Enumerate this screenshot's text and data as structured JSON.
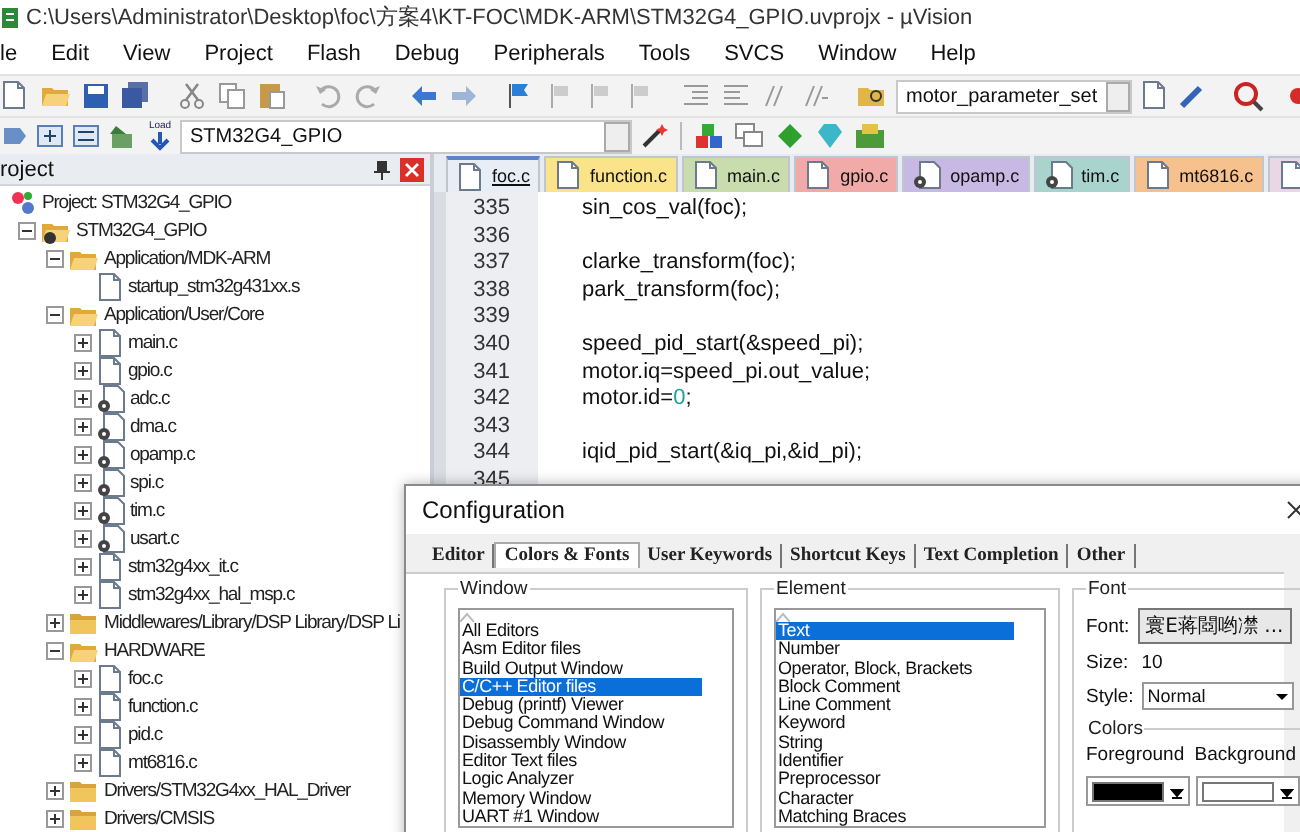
{
  "window": {
    "title": "C:\\Users\\Administrator\\Desktop\\foc\\方案4\\KT-FOC\\MDK-ARM\\STM32G4_GPIO.uvprojx - µVision"
  },
  "menu": [
    "le",
    "Edit",
    "View",
    "Project",
    "Flash",
    "Debug",
    "Peripherals",
    "Tools",
    "SVCS",
    "Window",
    "Help"
  ],
  "toolbar": {
    "find_combo": "motor_parameter_set",
    "load_label": "Load",
    "target_combo": "STM32G4_GPIO"
  },
  "project_panel": {
    "title": "roject",
    "tree": [
      {
        "label": "Project: STM32G4_GPIO",
        "kind": "project",
        "children": [
          {
            "label": "STM32G4_GPIO",
            "kind": "target",
            "expanded": true,
            "children": [
              {
                "label": "Application/MDK-ARM",
                "kind": "folder",
                "expanded": true,
                "children": [
                  {
                    "label": "startup_stm32g431xx.s",
                    "kind": "file"
                  }
                ]
              },
              {
                "label": "Application/User/Core",
                "kind": "folder",
                "expanded": true,
                "children": [
                  {
                    "label": "main.c",
                    "kind": "file",
                    "expanded": false
                  },
                  {
                    "label": "gpio.c",
                    "kind": "file",
                    "expanded": false
                  },
                  {
                    "label": "adc.c",
                    "kind": "config-file",
                    "expanded": false
                  },
                  {
                    "label": "dma.c",
                    "kind": "config-file",
                    "expanded": false
                  },
                  {
                    "label": "opamp.c",
                    "kind": "config-file",
                    "expanded": false
                  },
                  {
                    "label": "spi.c",
                    "kind": "config-file",
                    "expanded": false
                  },
                  {
                    "label": "tim.c",
                    "kind": "config-file",
                    "expanded": false
                  },
                  {
                    "label": "usart.c",
                    "kind": "config-file",
                    "expanded": false
                  },
                  {
                    "label": "stm32g4xx_it.c",
                    "kind": "file",
                    "expanded": false
                  },
                  {
                    "label": "stm32g4xx_hal_msp.c",
                    "kind": "file",
                    "expanded": false
                  }
                ]
              },
              {
                "label": "Middlewares/Library/DSP Library/DSP Li",
                "kind": "folder",
                "expanded": false
              },
              {
                "label": "HARDWARE",
                "kind": "folder",
                "expanded": true,
                "children": [
                  {
                    "label": "foc.c",
                    "kind": "file",
                    "expanded": false
                  },
                  {
                    "label": "function.c",
                    "kind": "file",
                    "expanded": false
                  },
                  {
                    "label": "pid.c",
                    "kind": "file",
                    "expanded": false
                  },
                  {
                    "label": "mt6816.c",
                    "kind": "file",
                    "expanded": false
                  }
                ]
              },
              {
                "label": "Drivers/STM32G4xx_HAL_Driver",
                "kind": "folder",
                "expanded": false
              },
              {
                "label": "Drivers/CMSIS",
                "kind": "folder",
                "expanded": false
              }
            ]
          }
        ]
      }
    ]
  },
  "editor": {
    "tabs": [
      {
        "label": "foc.c",
        "kind": "file",
        "color": "#e8eef6",
        "selected": true
      },
      {
        "label": "function.c",
        "kind": "file",
        "color": "#fbe38a",
        "selected": false
      },
      {
        "label": "main.c",
        "kind": "file",
        "color": "#c9dcae",
        "selected": false
      },
      {
        "label": "gpio.c",
        "kind": "file",
        "color": "#f2aaa8",
        "selected": false
      },
      {
        "label": "opamp.c",
        "kind": "config-file",
        "color": "#c7b8e4",
        "selected": false
      },
      {
        "label": "tim.c",
        "kind": "config-file",
        "color": "#a8d4cd",
        "selected": false
      },
      {
        "label": "mt6816.c",
        "kind": "file",
        "color": "#f7c18e",
        "selected": false
      },
      {
        "kind": "file",
        "color": "#ead7e6",
        "selected": false
      }
    ],
    "lines": [
      {
        "number": "335",
        "segments": [
          {
            "text": "sin_cos_val(foc);",
            "kind": "plain"
          }
        ]
      },
      {
        "number": "336"
      },
      {
        "number": "337",
        "segments": [
          {
            "text": "clarke_transform(foc);",
            "kind": "plain"
          }
        ]
      },
      {
        "number": "338",
        "segments": [
          {
            "text": "park_transform(foc);",
            "kind": "plain"
          }
        ]
      },
      {
        "number": "339"
      },
      {
        "number": "340",
        "segments": [
          {
            "text": "speed_pid_start(&speed_pi);",
            "kind": "plain"
          }
        ]
      },
      {
        "number": "341",
        "segments": [
          {
            "text": "motor.iq=speed_pi.out_value;",
            "kind": "plain"
          }
        ]
      },
      {
        "number": "342",
        "segments": [
          {
            "text": "motor.id=",
            "kind": "plain"
          },
          {
            "text": "0",
            "kind": "number"
          },
          {
            "text": ";",
            "kind": "plain"
          }
        ]
      },
      {
        "number": "343"
      },
      {
        "number": "344",
        "segments": [
          {
            "text": "iqid_pid_start(&iq_pi,&id_pi);",
            "kind": "plain"
          }
        ]
      },
      {
        "number": "345"
      }
    ]
  },
  "dialog": {
    "title": "Configuration",
    "tabs": [
      {
        "label": "Editor",
        "selected": false
      },
      {
        "label": "Colors & Fonts",
        "selected": true
      },
      {
        "label": "User Keywords",
        "selected": false
      },
      {
        "label": "Shortcut Keys",
        "selected": false
      },
      {
        "label": "Text Completion",
        "selected": false
      },
      {
        "label": "Other",
        "selected": false
      }
    ],
    "window_group": {
      "title": "Window",
      "items": [
        {
          "label": "All Editors",
          "selected": false
        },
        {
          "label": "Asm Editor files",
          "selected": false
        },
        {
          "label": "Build Output Window",
          "selected": false
        },
        {
          "label": "C/C++ Editor files",
          "selected": true
        },
        {
          "label": "Debug (printf) Viewer",
          "selected": false
        },
        {
          "label": "Debug Command Window",
          "selected": false
        },
        {
          "label": "Disassembly Window",
          "selected": false
        },
        {
          "label": "Editor Text files",
          "selected": false
        },
        {
          "label": "Logic Analyzer",
          "selected": false
        },
        {
          "label": "Memory Window",
          "selected": false
        },
        {
          "label": "UART #1 Window",
          "selected": false
        }
      ]
    },
    "element_group": {
      "title": "Element",
      "items": [
        {
          "label": "Text",
          "selected": true
        },
        {
          "label": "Number",
          "selected": false
        },
        {
          "label": "Operator, Block, Brackets",
          "selected": false
        },
        {
          "label": "Block Comment",
          "selected": false
        },
        {
          "label": "Line Comment",
          "selected": false
        },
        {
          "label": "Keyword",
          "selected": false
        },
        {
          "label": "String",
          "selected": false
        },
        {
          "label": "Identifier",
          "selected": false
        },
        {
          "label": "Preprocessor",
          "selected": false
        },
        {
          "label": "Character",
          "selected": false
        },
        {
          "label": "Matching Braces",
          "selected": false
        }
      ]
    },
    "font_group": {
      "title": "Font",
      "font_label": "Font:",
      "font_value": "寰E蒋閸哟凚 ...",
      "size_label": "Size:",
      "size_value": "10",
      "style_label": "Style:",
      "style_value": "Normal"
    },
    "colors_group": {
      "title": "Colors",
      "swatches": [
        {
          "label": "Foreground",
          "color": "#000000"
        },
        {
          "label": "Background",
          "color": "#ffffff"
        }
      ]
    }
  }
}
